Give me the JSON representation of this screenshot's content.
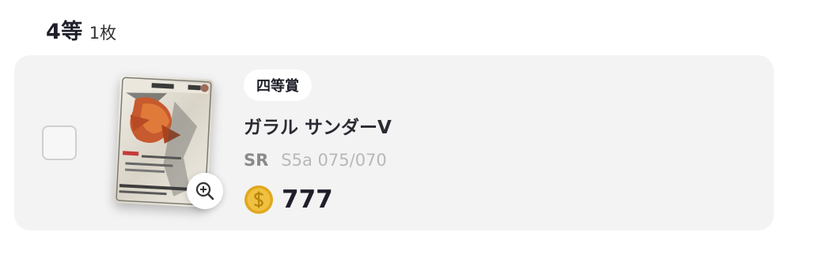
{
  "section": {
    "grade_title": "4等",
    "count": "1枚"
  },
  "item": {
    "prize_badge": "四等賞",
    "card_name": "ガラル サンダーV",
    "rarity": "SR",
    "set_code": "S5a 075/070",
    "price": "777",
    "card_image_icon": "card-artwork",
    "zoom_icon": "zoom-in-icon",
    "coin_icon": "coin-icon",
    "colors": {
      "coin": "#e7b62a",
      "row_background": "#f3f3f3"
    }
  }
}
